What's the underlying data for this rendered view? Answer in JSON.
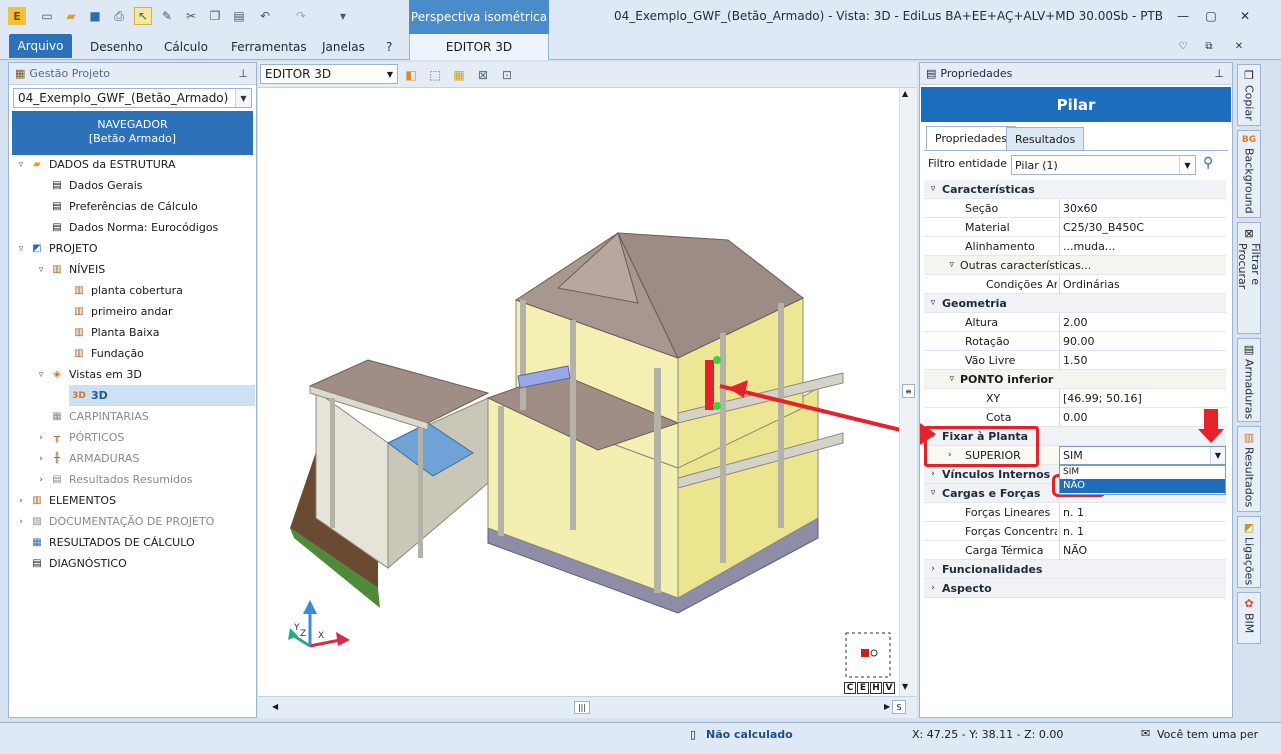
{
  "app": {
    "title": "04_Exemplo_GWF_(Betão_Armado) -  Vista: 3D - EdiLus BA+EE+AÇ+ALV+MD 30.00Sb - PTB",
    "context_tab_group": "Perspectiva isométrica",
    "context_tab": "EDITOR 3D"
  },
  "ribbon": {
    "tabs": [
      "Arquivo",
      "Desenho",
      "Cálculo",
      "Ferramentas",
      "Janelas",
      "?"
    ]
  },
  "left_panel": {
    "header": "Gestão Projeto",
    "project": "04_Exemplo_GWF_(Betão_Armado)",
    "navigator": [
      "NAVEGADOR",
      "[Betão Armado]"
    ],
    "tree": [
      {
        "label": "DADOS da ESTRUTURA"
      },
      {
        "label": "Dados Gerais"
      },
      {
        "label": "Preferências de Cálculo"
      },
      {
        "label": "Dados Norma: Eurocódigos"
      },
      {
        "label": "PROJETO"
      },
      {
        "label": "NÍVEIS"
      },
      {
        "label": "planta cobertura"
      },
      {
        "label": "primeiro andar"
      },
      {
        "label": "Planta Baixa"
      },
      {
        "label": "Fundação"
      },
      {
        "label": "Vistas em 3D"
      },
      {
        "label": "3D"
      },
      {
        "label": "CARPINTARIAS"
      },
      {
        "label": "PÓRTICOS"
      },
      {
        "label": "ARMADURAS"
      },
      {
        "label": "Resultados Resumidos"
      },
      {
        "label": "ELEMENTOS"
      },
      {
        "label": "DOCUMENTAÇÃO DE PROJETO"
      },
      {
        "label": "RESULTADOS DE CÁLCULO"
      },
      {
        "label": "DIAGNÓSTICO"
      }
    ]
  },
  "viewport": {
    "editor_select": "EDITOR 3D",
    "axis_labels": [
      "Z",
      "Y",
      "X"
    ],
    "view_buttons": [
      "C",
      "E",
      "H",
      "V"
    ],
    "scroll_corner": "S"
  },
  "properties": {
    "header": "Propriedades",
    "title": "Pilar",
    "tabs": [
      "Propriedades",
      "Resultados"
    ],
    "filter_label": "Filtro entidade",
    "filter_value": "Pilar (1)",
    "groups": {
      "caracteristicas": "Características",
      "secao_k": "Seção",
      "secao_v": "30x60",
      "material_k": "Material",
      "material_v": "C25/30_B450C",
      "alinhamento_k": "Alinhamento",
      "alinhamento_v": "...muda...",
      "outras": "Outras características...",
      "condicoes_k": "Condições Aml",
      "condicoes_v": "Ordinárias",
      "geometria": "Geometria",
      "altura_k": "Altura",
      "altura_v": "2.00",
      "rotacao_k": "Rotação",
      "rotacao_v": "90.00",
      "vao_k": "Vão Livre",
      "vao_v": "1.50",
      "ponto": "PONTO inferior",
      "xy_k": "XY",
      "xy_v": "[46.99; 50.16]",
      "cota_k": "Cota",
      "cota_v": "0.00",
      "fixar": "Fixar à Planta",
      "superior_k": "SUPERIOR",
      "superior_v": "SIM",
      "vinculos": "Vínculos Internos",
      "cargas": "Cargas e Forças",
      "forcas_lin_k": "Forças Lineares",
      "forcas_lin_v": "n. 1",
      "forcas_conc_k": "Forças Concentrac",
      "forcas_conc_v": "n. 1",
      "carga_term_k": "Carga Térmica",
      "carga_term_v": "NÃO",
      "funcionalidades": "Funcionalidades",
      "aspecto": "Aspecto"
    },
    "dropdown_options": [
      "SIM",
      "NÃO"
    ]
  },
  "side_tabs": [
    "Copiar",
    "Background",
    "Filtrar e Procurar",
    "Armaduras",
    "Resultados",
    "Ligações",
    "BIM"
  ],
  "status": {
    "calc": "Não calculado",
    "coords": "X: 47.25 - Y: 38.11 - Z: 0.00",
    "message": "Você tem uma per"
  },
  "colors": {
    "accent": "#2d71b8",
    "annotation": "#e5222a"
  }
}
